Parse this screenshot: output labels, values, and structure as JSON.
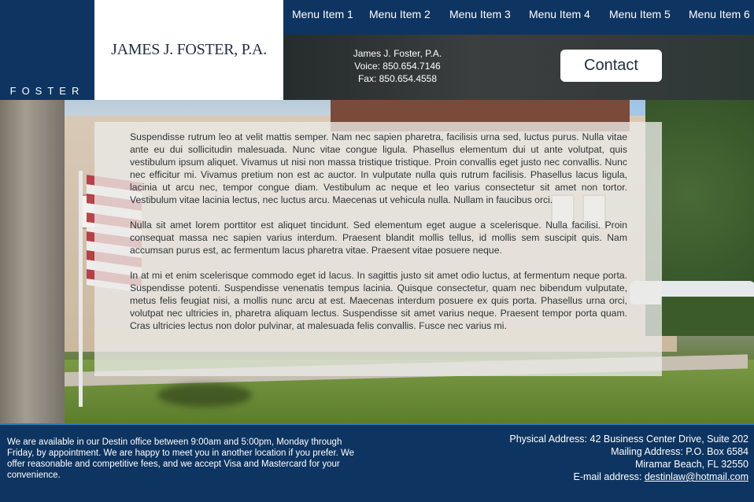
{
  "brand": {
    "side_text": "FOSTER",
    "logo_text": "JAMES J. FOSTER, P.A."
  },
  "nav": {
    "items": [
      {
        "label": "Menu Item 1"
      },
      {
        "label": "Menu Item 2"
      },
      {
        "label": "Menu Item 3"
      },
      {
        "label": "Menu Item 4"
      },
      {
        "label": "Menu Item 5"
      },
      {
        "label": "Menu Item 6"
      }
    ]
  },
  "banner": {
    "name": "James J. Foster, P.A.",
    "voice": "Voice: 850.654.7146",
    "fax": "Fax: 850.654.4558",
    "contact_label": "Contact"
  },
  "main": {
    "paragraphs": [
      "Suspendisse rutrum leo at velit mattis semper. Nam nec sapien pharetra, facilisis urna sed, luctus purus. Nulla vitae ante eu dui sollicitudin malesuada. Nunc vitae congue ligula. Phasellus elementum dui ut ante volutpat, quis vestibulum ipsum aliquet. Vivamus ut nisi non massa tristique tristique. Proin convallis eget justo nec convallis. Nunc nec efficitur mi. Vivamus pretium non est ac auctor. In vulputate nulla quis rutrum facilisis. Phasellus lacus ligula, lacinia ut arcu nec, tempor congue diam. Vestibulum ac neque et leo varius consectetur sit amet non tortor. Vestibulum vitae lacinia lectus, nec luctus arcu. Maecenas ut vehicula nulla. Nullam in faucibus orci.",
      "Nulla sit amet lorem porttitor est aliquet tincidunt. Sed elementum eget augue a scelerisque. Nulla facilisi. Proin consequat massa nec sapien varius interdum. Praesent blandit mollis tellus, id mollis sem suscipit quis. Nam accumsan purus est, ac fermentum lacus pharetra vitae. Praesent vitae posuere neque.",
      "In at mi et enim scelerisque commodo eget id lacus. In sagittis justo sit amet odio luctus, at fermentum neque porta. Suspendisse potenti. Suspendisse venenatis tempus lacinia. Quisque consectetur, quam nec bibendum vulputate, metus felis feugiat nisi, a mollis nunc arcu at est. Maecenas interdum posuere ex quis porta. Phasellus urna orci, volutpat nec ultricies in, pharetra aliquam lectus. Suspendisse sit amet varius neque. Praesent tempor porta quam. Cras ultricies lectus non dolor pulvinar, at malesuada felis convallis. Fusce nec varius mi."
    ]
  },
  "footer": {
    "availability": "We are available in our Destin office between 9:00am and 5:00pm, Monday through Friday, by appointment.  We are happy to meet you in another location if you prefer.  We offer reasonable and competitive fees, and we accept Visa and Mastercard for your convenience.",
    "physical_address": "Physical Address: 42 Business Center Drive, Suite 202",
    "mailing_address": "Mailing Address: P.O. Box 6584",
    "city_line": "Miramar Beach, FL 32550",
    "email_prefix": "E-mail address: ",
    "email": "destinlaw@hotmail.com"
  }
}
